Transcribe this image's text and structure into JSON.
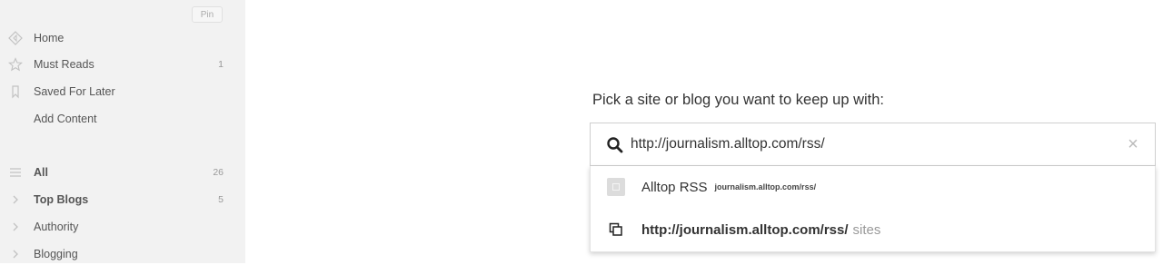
{
  "sidebar": {
    "pin_label": "Pin",
    "items": [
      {
        "label": "Home",
        "icon": "home-icon",
        "count": ""
      },
      {
        "label": "Must Reads",
        "icon": "star-icon",
        "count": "1"
      },
      {
        "label": "Saved For Later",
        "icon": "bookmark-icon",
        "count": ""
      },
      {
        "label": "Add Content",
        "icon": "",
        "count": ""
      }
    ],
    "feeds": [
      {
        "label": "All",
        "icon": "list-icon",
        "count": "26",
        "bold": true
      },
      {
        "label": "Top Blogs",
        "icon": "chevron-right-icon",
        "count": "5",
        "bold": true
      },
      {
        "label": "Authority",
        "icon": "chevron-right-icon",
        "count": ""
      },
      {
        "label": "Blogging",
        "icon": "chevron-right-icon",
        "count": ""
      }
    ]
  },
  "main": {
    "prompt": "Pick a site or blog you want to keep up with:",
    "search": {
      "value": "http://journalism.alltop.com/rss/",
      "placeholder": ""
    },
    "suggestions": [
      {
        "title": "Alltop RSS",
        "url": "journalism.alltop.com/rss/"
      },
      {
        "title": "http://journalism.alltop.com/rss/",
        "suffix": "sites"
      }
    ]
  },
  "colors": {
    "sidebar_bg": "#f2f2f2",
    "icon": "#c2c2c2"
  }
}
